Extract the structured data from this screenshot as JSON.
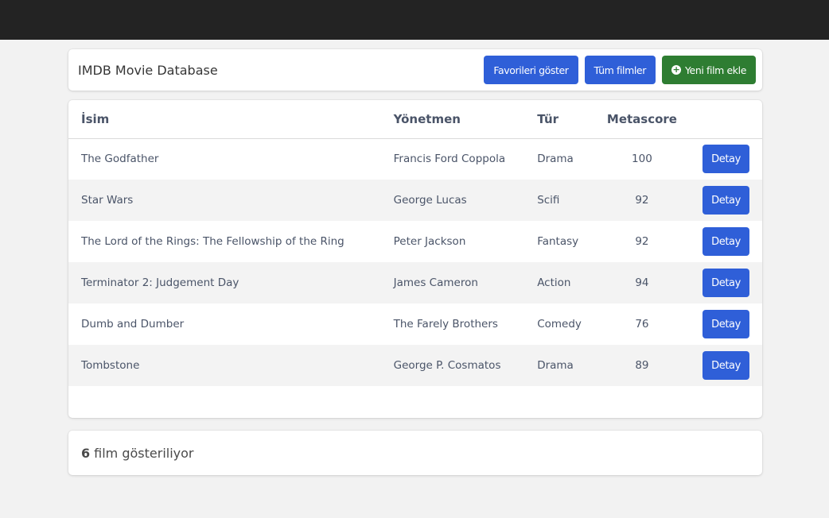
{
  "header": {
    "title": "IMDB Movie Database",
    "buttons": {
      "favorites": "Favorileri göster",
      "all": "Tüm filmler",
      "add": "Yeni film ekle"
    }
  },
  "table": {
    "columns": {
      "name": "İsim",
      "director": "Yönetmen",
      "genre": "Tür",
      "metascore": "Metascore"
    },
    "detail_label": "Detay",
    "rows": [
      {
        "name": "The Godfather",
        "director": "Francis Ford Coppola",
        "genre": "Drama",
        "metascore": "100"
      },
      {
        "name": "Star Wars",
        "director": "George Lucas",
        "genre": "Scifi",
        "metascore": "92"
      },
      {
        "name": "The Lord of the Rings: The Fellowship of the Ring",
        "director": "Peter Jackson",
        "genre": "Fantasy",
        "metascore": "92"
      },
      {
        "name": "Terminator 2: Judgement Day",
        "director": "James Cameron",
        "genre": "Action",
        "metascore": "94"
      },
      {
        "name": "Dumb and Dumber",
        "director": "The Farely Brothers",
        "genre": "Comedy",
        "metascore": "76"
      },
      {
        "name": "Tombstone",
        "director": "George P. Cosmatos",
        "genre": "Drama",
        "metascore": "89"
      }
    ]
  },
  "footer": {
    "count": "6",
    "text": "film gösteriliyor"
  },
  "colors": {
    "primary": "#2f5fd8",
    "success": "#2e7d32",
    "topbar": "#232323"
  }
}
